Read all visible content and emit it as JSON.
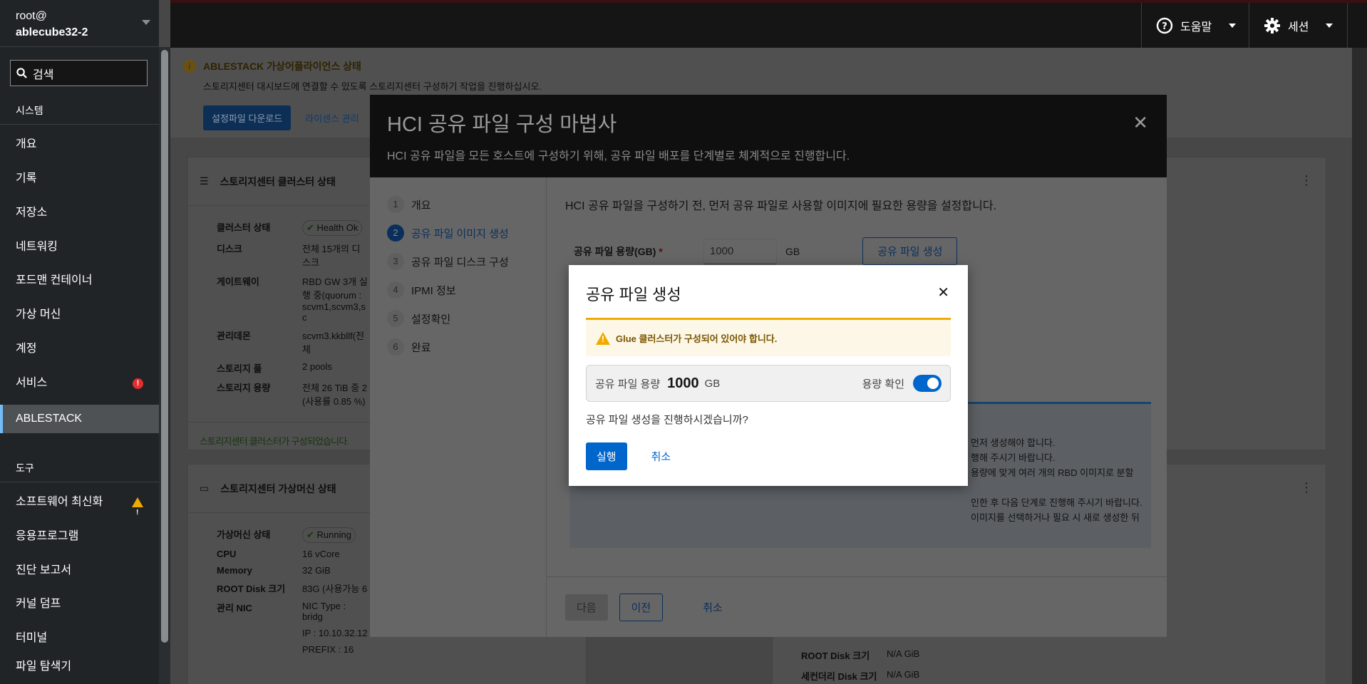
{
  "sidebar": {
    "user": "root@",
    "host": "ablecube32-2",
    "search_placeholder": "검색",
    "section_system": "시스템",
    "items": [
      {
        "label": "개요"
      },
      {
        "label": "기록"
      },
      {
        "label": "저장소"
      },
      {
        "label": "네트워킹"
      },
      {
        "label": "포드맨 컨테이너"
      },
      {
        "label": "가상 머신"
      },
      {
        "label": "계정"
      },
      {
        "label": "서비스",
        "badge": "error"
      },
      {
        "label": "ABLESTACK",
        "active": true
      }
    ],
    "section_tools": "도구",
    "tools": [
      {
        "label": "소프트웨어 최신화",
        "badge": "warning"
      },
      {
        "label": "응용프로그램"
      },
      {
        "label": "진단 보고서"
      },
      {
        "label": "커널 덤프"
      },
      {
        "label": "터미널"
      },
      {
        "label": "파일 탐색기"
      }
    ]
  },
  "topbar": {
    "help": "도움말",
    "session": "세션"
  },
  "alert": {
    "title": "ABLESTACK 가상어플라이언스 상태",
    "body": "스토리지센터 대시보드에 연결할 수 있도록 스토리지센터 구성하기 작업을 진행하십시오.",
    "download": "설정파일 다운로드",
    "license": "라이센스 관리"
  },
  "cluster_card": {
    "title": "스토리지센터 클러스터 상태",
    "rows": [
      {
        "k": "클러스터 상태",
        "v": "Health Ok"
      },
      {
        "k": "디스크",
        "v": "전체 15개의 디스크"
      },
      {
        "k": "게이트웨이",
        "v": "RBD GW 3개 실행 중(quorum : scvm1,scvm3,sc"
      },
      {
        "k": "관리데몬",
        "v": "scvm3.kkbllf(전체"
      },
      {
        "k": "스토리지 풀",
        "v": "2 pools"
      },
      {
        "k": "스토리지 용량",
        "v": "전체 26 TiB 중 2 (사용률 0.85 %)"
      }
    ],
    "footer": "스토리지센터 클러스터가 구성되었습니다."
  },
  "vm_card": {
    "title": "스토리지센터 가상머신 상태",
    "rows": [
      {
        "k": "가상머신 상태",
        "v": "Running"
      },
      {
        "k": "CPU",
        "v": "16 vCore"
      },
      {
        "k": "Memory",
        "v": "32 GiB"
      },
      {
        "k": "ROOT Disk 크기",
        "v": "83G (사용가능 6"
      },
      {
        "k": "관리 NIC",
        "v": "NIC Type : bridg"
      },
      {
        "k": "",
        "v": "IP : 10.10.32.12"
      },
      {
        "k": "",
        "v": "PREFIX : 16"
      }
    ]
  },
  "right_card": {
    "rows": [
      {
        "k": "ROOT Disk 크기",
        "v": "N/A GiB"
      },
      {
        "k": "세컨더리 Disk 크기",
        "v": "N/A GiB"
      }
    ]
  },
  "wizard": {
    "title": "HCI 공유 파일 구성 마법사",
    "description": "HCI 공유 파일을 모든 호스트에 구성하기 위해, 공유 파일 배포를 단계별로 체계적으로 진행합니다.",
    "steps": [
      {
        "n": "1",
        "label": "개요"
      },
      {
        "n": "2",
        "label": "공유 파일 이미지 생성",
        "current": true
      },
      {
        "n": "3",
        "label": "공유 파일 디스크 구성"
      },
      {
        "n": "4",
        "label": "IPMI 정보"
      },
      {
        "n": "5",
        "label": "설정확인"
      },
      {
        "n": "6",
        "label": "완료"
      }
    ],
    "intro": "HCI 공유 파일을 구성하기 전, 먼저 공유 파일로 사용할 이미지에 필요한 용량을 설정합니다.",
    "size_label": "공유 파일 용량(GB)",
    "required": "*",
    "size_value": "1000",
    "unit": "GB",
    "create_button": "공유 파일 생성",
    "info_lines": [
      "먼저 생성해야 합니다.",
      "행해 주시기 바랍니다.",
      "용량에 맞게 여러 개의 RBD 이미지로 분할",
      "인한 후 다음 단계로 진행해 주시기 바랍니다.",
      "이미지를 선택하거나 필요 시 새로 생성한 뒤"
    ],
    "next": "다음",
    "prev": "이전",
    "cancel": "취소"
  },
  "dialog": {
    "title": "공유 파일 생성",
    "warning": "Glue 클러스터가 구성되어 있어야 합니다.",
    "size_label": "공유 파일 용량",
    "size_value": "1000",
    "unit": "GB",
    "confirm_label": "용량 확인",
    "confirm_on": true,
    "question": "공유 파일 생성을 진행하시겠습니까?",
    "run": "실행",
    "cancel": "취소"
  }
}
